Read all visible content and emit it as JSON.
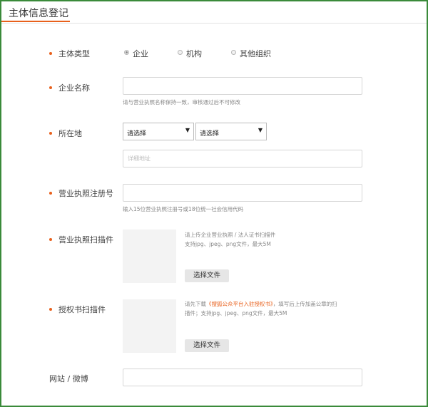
{
  "header": {
    "title": "主体信息登记"
  },
  "entity_type": {
    "label": "主体类型",
    "options": [
      "企业",
      "机构",
      "其他组织"
    ],
    "selected_index": 0
  },
  "company_name": {
    "label": "企业名称",
    "value": "",
    "hint": "请与营业执照名称保持一致，审核通过后不可修改"
  },
  "location": {
    "label": "所在地",
    "province": "请选择",
    "city": "请选择",
    "address_placeholder": "详细地址"
  },
  "license_number": {
    "label": "营业执照注册号",
    "value": "",
    "hint": "输入15位营业执照注册号或18位统一社会信用代码"
  },
  "license_scan": {
    "label": "营业执照扫描件",
    "hint_line1": "请上传企业营业执照 / 法人证书扫描件",
    "hint_line2": "支持jpg、jpeg、png文件，最大5M",
    "button": "选择文件"
  },
  "authorization_scan": {
    "label": "授权书扫描件",
    "hint_prefix": "请先下载",
    "hint_link": "《搜狐公众平台入驻授权书》",
    "hint_suffix": "，填写后上传加盖公章的扫",
    "hint_line2": "描件；支持jpg、jpeg、png文件，最大5M",
    "button": "选择文件"
  },
  "website": {
    "label": "网站 / 微博",
    "value": ""
  },
  "colors": {
    "accent": "#e8601c",
    "frame": "#3a8a3a"
  }
}
